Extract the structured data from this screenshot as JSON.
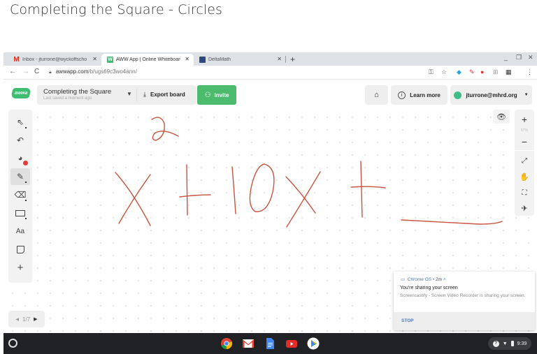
{
  "page_title": "Completing the Square - Circles",
  "browser": {
    "tabs": [
      {
        "label": "Inbox - jturrone@wyckoffschools",
        "favicon": "gmail-icon",
        "active": false
      },
      {
        "label": "AWW App | Online Whiteboard",
        "favicon": "aww-icon",
        "active": true
      },
      {
        "label": "DeltaMath",
        "favicon": "deltamath-icon",
        "active": false
      }
    ],
    "close_glyph": "✕",
    "new_tab_glyph": "+",
    "url_host": "awwapp.com",
    "url_path": "/b/ugs69c3wo4ann/",
    "window_controls": [
      "_",
      "❐",
      "✕"
    ]
  },
  "header": {
    "logo_text": "awwa",
    "board_name": "Completing the Square",
    "saved_status": "Last saved a moment ago",
    "export_label": "Export board",
    "invite_label": "Invite",
    "learn_more_label": "Learn more",
    "user_email": "jturrone@mhrd.org"
  },
  "toolbar_left": [
    {
      "name": "select-tool",
      "glyph": "⇖",
      "selected": false
    },
    {
      "name": "undo-tool",
      "glyph": "↶",
      "selected": false
    },
    {
      "name": "color-palette-tool",
      "glyph": "🎨",
      "selected": false,
      "active_color": "#e53935"
    },
    {
      "name": "pen-tool",
      "glyph": "✎",
      "selected": true
    },
    {
      "name": "eraser-tool",
      "glyph": "⌫",
      "selected": false
    },
    {
      "name": "shape-tool",
      "glyph": "▭",
      "selected": false
    },
    {
      "name": "text-tool",
      "glyph": "Aa",
      "selected": false
    },
    {
      "name": "sticky-note-tool",
      "glyph": "◫",
      "selected": false
    },
    {
      "name": "add-tool",
      "glyph": "+",
      "selected": false
    }
  ],
  "toolbar_right": {
    "zoom_in": "+",
    "zoom_level": "67%",
    "zoom_out": "−",
    "fit": "⤢",
    "pan": "✋",
    "center": "⛶",
    "laser": "✈"
  },
  "canvas": {
    "ink_color": "#c8533e",
    "handwriting": "x² + 10x + ___"
  },
  "pager": {
    "prev": "◀",
    "label": "1/7",
    "next": "▶"
  },
  "notification": {
    "source": "Chrome OS",
    "age": "2m",
    "title": "You're sharing your screen",
    "body": "Screencastify - Screen Video Recorder is sharing your screen.",
    "action": "STOP"
  },
  "shelf": {
    "apps": [
      "chrome-icon",
      "gmail-icon",
      "docs-icon",
      "youtube-icon",
      "play-store-icon"
    ],
    "time": "9:39"
  }
}
